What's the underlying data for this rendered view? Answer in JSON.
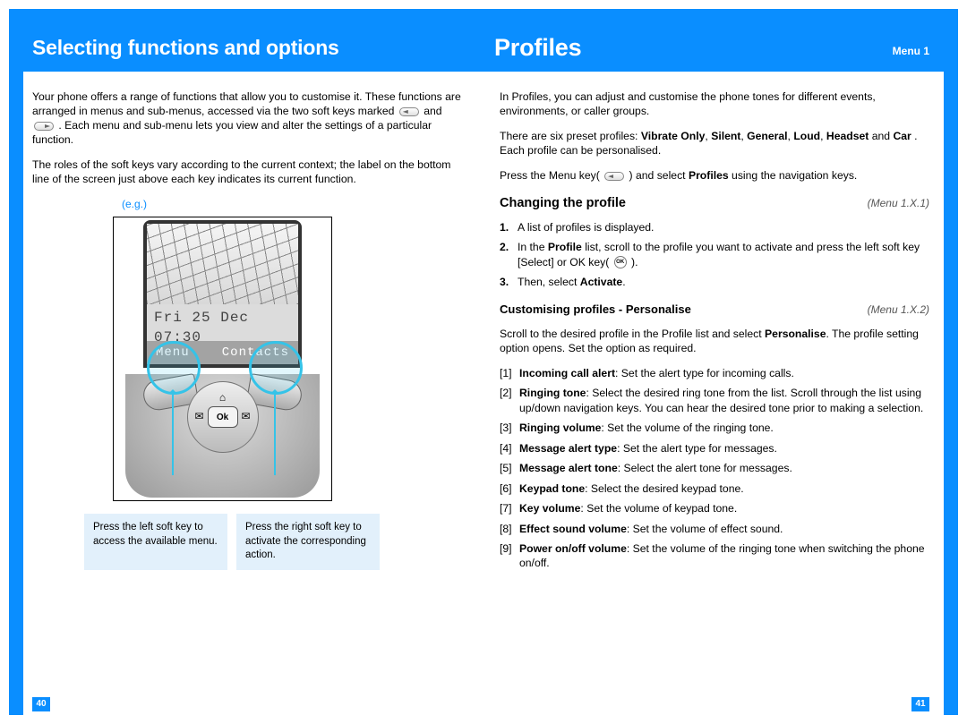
{
  "left": {
    "title": "Selecting functions and options",
    "para1a": "Your phone offers a range of functions that allow you to customise it. These functions are arranged in menus and sub-menus, accessed via the two soft keys marked ",
    "para1b": " and ",
    "para1c": " . Each menu and sub-menu lets you view and alter the settings of a particular function.",
    "para2": "The roles of the soft keys vary according to the current context; the label on the bottom line of the screen just above each key indicates its current function.",
    "eg": "(e.g.)",
    "phone": {
      "date": "Fri 25 Dec",
      "time": "07:30",
      "soft_left": "Menu",
      "soft_right": "Contacts",
      "ok": "Ok"
    },
    "callout_left": "Press the left soft key to access the available menu.",
    "callout_right": "Press the right soft key to activate the corresponding action.",
    "page": "40"
  },
  "right": {
    "title": "Profiles",
    "menu": "Menu 1",
    "intro1": "In Profiles, you can adjust and customise the phone tones for different events, environments, or caller groups.",
    "intro2a": "There are six preset profiles: ",
    "intro2_vib": "Vibrate Only",
    "intro2_sil": "Silent",
    "intro2_gen": "General",
    "intro2_loud": "Loud",
    "intro2_head": "Headset",
    "intro2_and": " and ",
    "intro2_car": "Car",
    "intro2b": ". Each profile can be personalised.",
    "intro3a": "Press the Menu key( ",
    "intro3b": " ) and select ",
    "intro3_prof": "Profiles",
    "intro3c": " using the navigation keys.",
    "sec1": {
      "title": "Changing the profile",
      "menu": "(Menu 1.X.1)",
      "s1": "A list of profiles is displayed.",
      "s2a": "In the ",
      "s2_profile": "Profile",
      "s2b": " list, scroll to the profile you want to activate and press the left soft key [Select] or OK key( ",
      "s2c": " ).",
      "s3a": "Then, select ",
      "s3_act": "Activate",
      "s3b": "."
    },
    "sec2": {
      "title_a": "Customising profiles - ",
      "title_b": "Personalise",
      "menu": "(Menu 1.X.2)",
      "intro_a": "Scroll to the desired profile in the Profile list and select ",
      "intro_pers": "Personalise",
      "intro_b": ". The profile setting option opens. Set the option as required.",
      "items": [
        {
          "t": "Incoming call alert",
          "d": ": Set the alert type for incoming calls."
        },
        {
          "t": "Ringing tone",
          "d": ": Select the desired ring tone from the list. Scroll through the list using up/down navigation keys. You can hear the desired tone prior to making a selection."
        },
        {
          "t": "Ringing volume",
          "d": ": Set the volume of the ringing tone."
        },
        {
          "t": "Message alert type",
          "d": ": Set the alert type for messages."
        },
        {
          "t": "Message alert tone",
          "d": ": Select the alert tone for messages."
        },
        {
          "t": "Keypad tone",
          "d": ": Select the desired keypad tone."
        },
        {
          "t": "Key volume",
          "d": ": Set the volume of keypad tone."
        },
        {
          "t": "Effect sound volume",
          "d": ": Set the volume of effect sound."
        },
        {
          "t": "Power on/off volume",
          "d": ": Set the volume of the ringing tone when switching the phone on/off."
        }
      ]
    },
    "page": "41"
  }
}
